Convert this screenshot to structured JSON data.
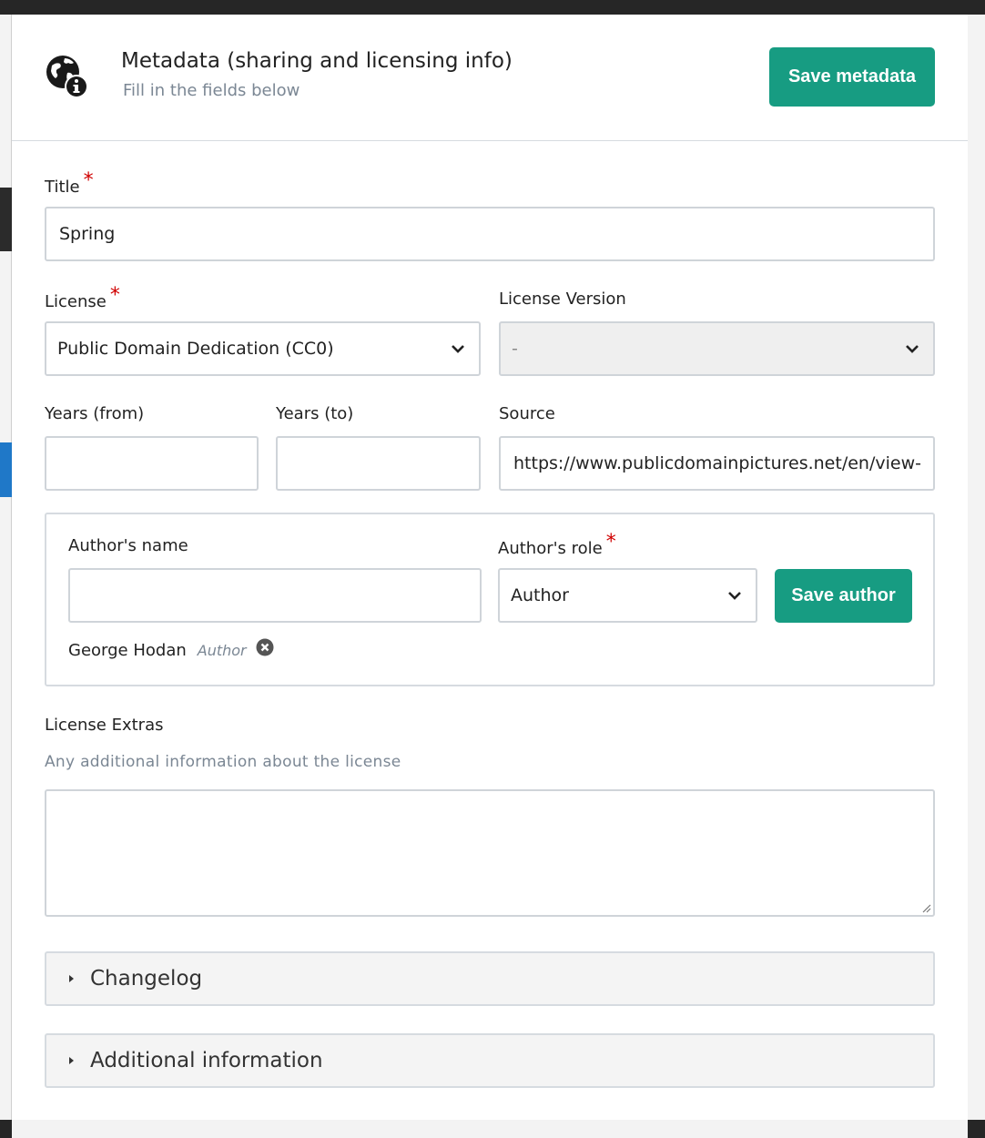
{
  "modal": {
    "title": "Metadata (sharing and licensing info)",
    "subtitle": "Fill in the fields below",
    "save_button": "Save metadata",
    "icon": "globe-info-icon"
  },
  "fields": {
    "title": {
      "label": "Title",
      "value": "Spring"
    },
    "license": {
      "label": "License",
      "value": "Public Domain Dedication (CC0)"
    },
    "license_version": {
      "label": "License Version",
      "value": "-"
    },
    "years_from": {
      "label": "Years (from)",
      "value": ""
    },
    "years_to": {
      "label": "Years (to)",
      "value": ""
    },
    "source": {
      "label": "Source",
      "value": "https://www.publicdomainpictures.net/en/view-"
    }
  },
  "authors": {
    "name_label": "Author's name",
    "name_value": "",
    "role_label": "Author's role",
    "role_value": "Author",
    "save_button": "Save author",
    "list": [
      {
        "name": "George Hodan",
        "role": "Author"
      }
    ]
  },
  "license_extras": {
    "label": "License Extras",
    "description": "Any additional information about the license",
    "value": ""
  },
  "accordions": [
    {
      "label": "Changelog"
    },
    {
      "label": "Additional information"
    }
  ],
  "required_marker": "*",
  "colors": {
    "accent": "#179c82",
    "required": "#d00000",
    "muted_text": "#7b8794",
    "border": "#cfd4d9"
  }
}
